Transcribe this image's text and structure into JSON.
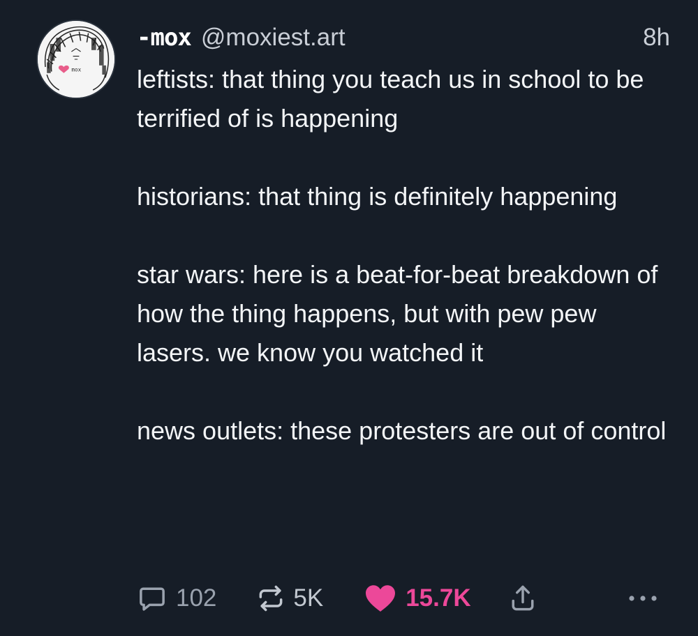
{
  "post": {
    "author": {
      "display_name": "-mox",
      "handle": "@moxiest.art"
    },
    "timestamp": "8h",
    "paragraphs": [
      "leftists: that thing you teach us in school to be terrified of is happening",
      "historians: that thing is definitely happening",
      "star wars: here is a beat-for-beat breakdown of how the thing happens, but with pew pew lasers. we know you watched it",
      "news outlets: these protesters are out of control"
    ],
    "actions": {
      "reply_count": "102",
      "repost_count": "5K",
      "like_count": "15.7K",
      "liked": true
    },
    "icons": {
      "reply": "speech-bubble-icon",
      "repost": "repost-arrows-icon",
      "like": "heart-icon",
      "share": "share-arrow-icon",
      "more": "ellipsis-icon"
    },
    "colors": {
      "background": "#161d27",
      "like_accent": "#ec4899"
    }
  }
}
